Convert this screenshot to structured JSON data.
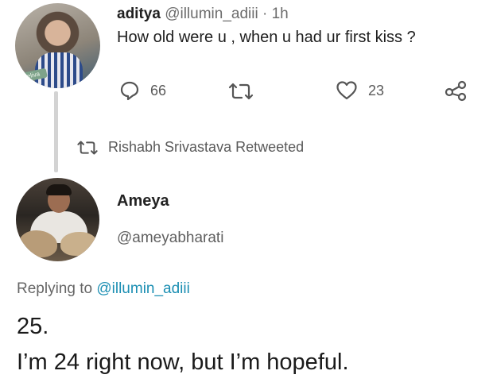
{
  "tweet1": {
    "name": "aditya",
    "handle": "@illumin_adiii",
    "separator": "·",
    "time": "1h",
    "text": "How old were u , when u had ur first kiss ?",
    "avatar_badge": "eliva",
    "actions": {
      "reply_icon": "reply-icon",
      "reply_count": "66",
      "retweet_icon": "retweet-icon",
      "like_icon": "heart-icon",
      "like_count": "23",
      "share_icon": "share-icon"
    }
  },
  "retweet_notice": {
    "icon": "retweet-icon",
    "text": "Rishabh Srivastava Retweeted"
  },
  "tweet2": {
    "name": "Ameya",
    "handle": "@ameyabharati",
    "replying_prefix": "Replying to",
    "replying_handle": "@illumin_adiii",
    "lines": [
      "25.",
      "I’m 24 right now, but I’m hopeful."
    ]
  },
  "colors": {
    "link": "#1c8fb3",
    "secondary_text": "#5a5a5a",
    "thread_line": "#d3d3d3"
  }
}
